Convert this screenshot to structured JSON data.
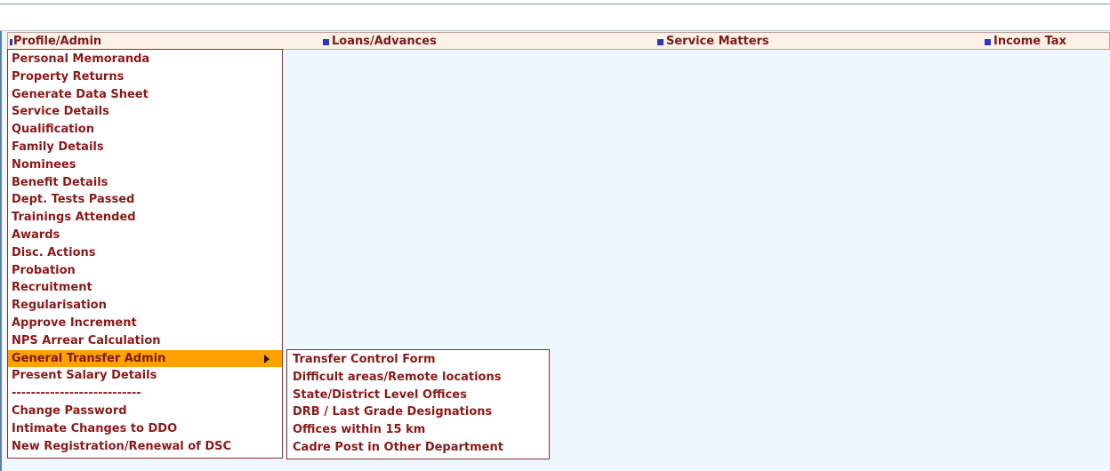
{
  "menubar": {
    "items": [
      {
        "label": "Profile/Admin"
      },
      {
        "label": "Loans/Advances"
      },
      {
        "label": "Service Matters"
      },
      {
        "label": "Income Tax"
      }
    ]
  },
  "profile_menu": {
    "items": [
      {
        "label": "Personal Memoranda"
      },
      {
        "label": "Property Returns"
      },
      {
        "label": "Generate Data Sheet"
      },
      {
        "label": "Service Details"
      },
      {
        "label": "Qualification"
      },
      {
        "label": "Family Details"
      },
      {
        "label": "Nominees"
      },
      {
        "label": "Benefit Details"
      },
      {
        "label": "Dept. Tests Passed"
      },
      {
        "label": "Trainings Attended"
      },
      {
        "label": "Awards"
      },
      {
        "label": "Disc. Actions"
      },
      {
        "label": "Probation"
      },
      {
        "label": "Recruitment"
      },
      {
        "label": "Regularisation"
      },
      {
        "label": "Approve Increment"
      },
      {
        "label": "NPS Arrear Calculation"
      },
      {
        "label": "General Transfer Admin"
      },
      {
        "label": "Present Salary Details"
      },
      {
        "label": "---------------------------"
      },
      {
        "label": "Change Password"
      },
      {
        "label": "Intimate Changes to DDO"
      },
      {
        "label": "New Registration/Renewal of DSC"
      }
    ]
  },
  "transfer_submenu": {
    "items": [
      {
        "label": "Transfer Control Form"
      },
      {
        "label": "Difficult areas/Remote locations"
      },
      {
        "label": "State/District Level Offices"
      },
      {
        "label": "DRB / Last Grade Designations"
      },
      {
        "label": "Offices within 15 km"
      },
      {
        "label": "Cadre Post in Other Department"
      }
    ]
  },
  "colors": {
    "menu_text": "#8a1a1a",
    "highlight": "#ffa200",
    "bullet": "#2a35c0",
    "page_bg": "#eef6ff",
    "menubar_bg": "#fdf0e6"
  },
  "icons": {
    "menubar_bullet": "square-bullet-icon",
    "submenu_arrow": "triangle-right-icon"
  }
}
